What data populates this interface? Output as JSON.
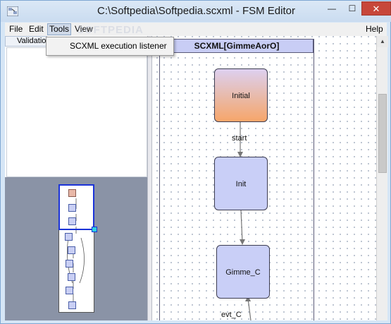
{
  "window": {
    "title": "C:\\Softpedia\\Softpedia.scxml - FSM Editor",
    "minimize_glyph": "—",
    "maximize_glyph": "☐",
    "close_glyph": "✕",
    "app_icon": "fsm-app-icon"
  },
  "menubar": {
    "items": [
      {
        "label": "File",
        "active": false
      },
      {
        "label": "Edit",
        "active": false
      },
      {
        "label": "Tools",
        "active": true
      },
      {
        "label": "View",
        "active": false
      }
    ],
    "help": "Help"
  },
  "dropdown": {
    "items": [
      "SCXML execution listener"
    ]
  },
  "watermark": "SOFTPEDIA",
  "left_panel": {
    "tab_label": "Validation"
  },
  "diagram": {
    "scxml_title": "SCXML[GimmeAorO]",
    "states": [
      {
        "label": "Initial",
        "kind": "initial"
      },
      {
        "label": "Init",
        "kind": "normal"
      },
      {
        "label": "Gimme_C",
        "kind": "normal"
      }
    ],
    "transitions": [
      {
        "label": "start"
      },
      {
        "label": "evt_C"
      }
    ]
  },
  "colors": {
    "state_fill": "#c9cff7",
    "initial_gradient_end": "#f7a66a",
    "header_fill": "#c8cdf5",
    "overview_bg": "#8a93a6",
    "viewport_border": "#1b33d8"
  }
}
